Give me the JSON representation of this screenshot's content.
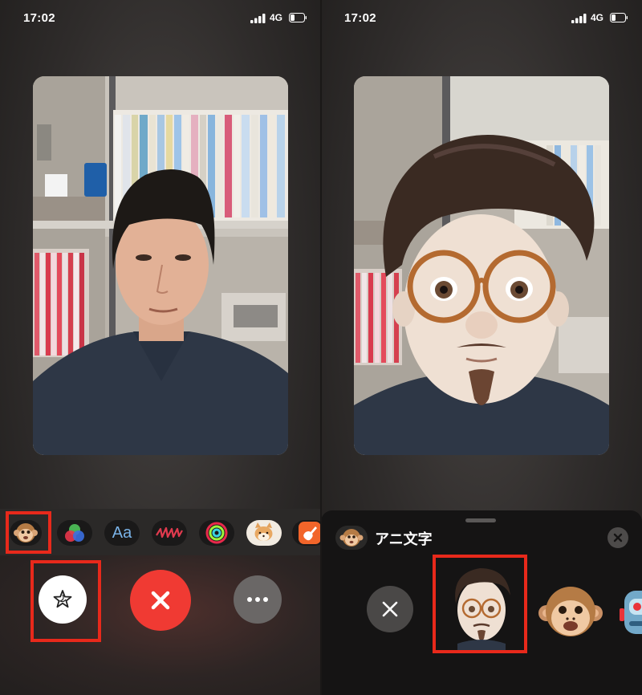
{
  "status": {
    "time": "17:02",
    "network": "4G"
  },
  "left_screen": {
    "effects": [
      {
        "name": "animoji-effect",
        "icon": "monkey-icon"
      },
      {
        "name": "filters-effect",
        "icon": "color-circles-icon"
      },
      {
        "name": "text-effect",
        "label": "Aa"
      },
      {
        "name": "shapes-effect",
        "icon": "scribble-icon"
      },
      {
        "name": "activity-stickers-effect",
        "icon": "activity-rings-icon"
      },
      {
        "name": "sticker-effect",
        "icon": "shiba-sticker-icon"
      },
      {
        "name": "music-effect",
        "icon": "guitar-app-icon"
      }
    ],
    "buttons": {
      "effects": "star-icon",
      "end_call": "close-icon",
      "more": "ellipsis-icon"
    }
  },
  "right_screen": {
    "sheet": {
      "title": "アニ文字",
      "options": [
        "none-option",
        "memoji-man-option",
        "monkey-option",
        "robot-option"
      ]
    }
  },
  "colors": {
    "highlight": "#e8291b",
    "end_call": "#f03a33"
  }
}
